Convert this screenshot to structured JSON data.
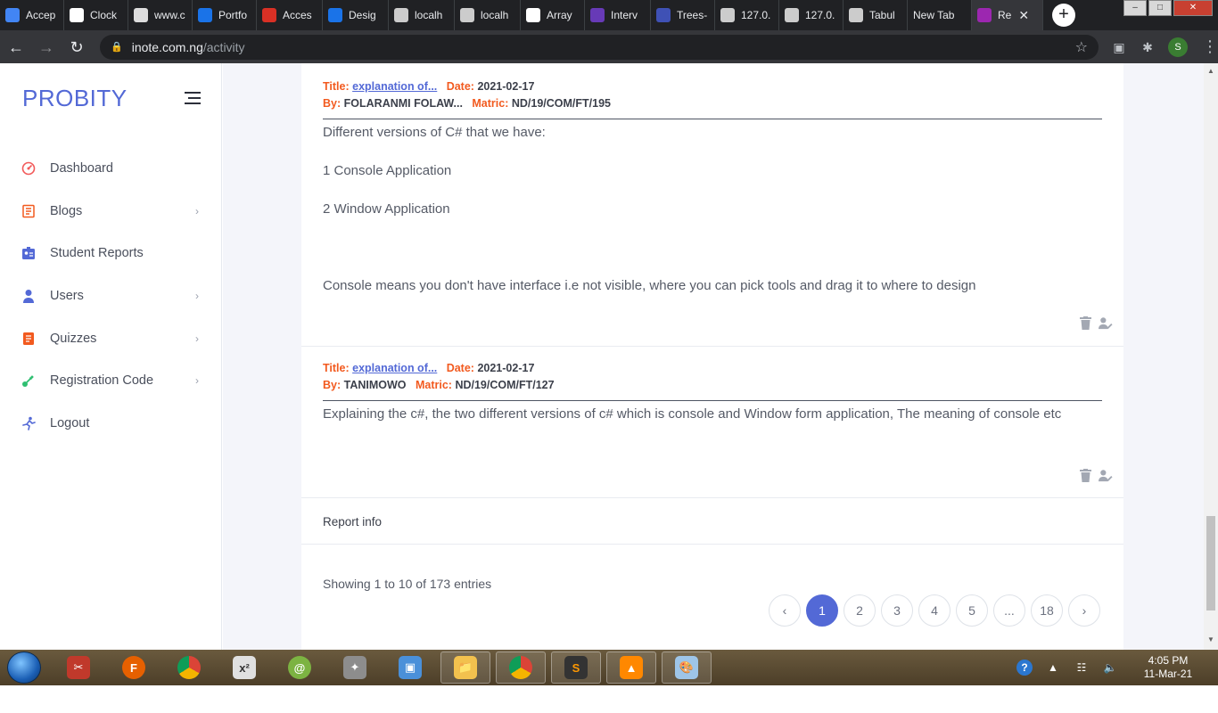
{
  "browser": {
    "tabs": [
      {
        "label": "Accep",
        "icon": "docs-icon",
        "color": "#4285f4"
      },
      {
        "label": "Clock",
        "icon": "clock-icon",
        "color": "#ffffff"
      },
      {
        "label": "www.c",
        "icon": "globe-icon",
        "color": "#dddddd"
      },
      {
        "label": "Portfo",
        "icon": "canva-icon",
        "color": "#1a73e8"
      },
      {
        "label": "Acces",
        "icon": "mail-icon",
        "color": "#d93025"
      },
      {
        "label": "Desig",
        "icon": "canva-icon",
        "color": "#1a73e8"
      },
      {
        "label": "localh",
        "icon": "server-icon",
        "color": "#cccccc"
      },
      {
        "label": "localh",
        "icon": "server-icon",
        "color": "#cccccc"
      },
      {
        "label": "Array",
        "icon": "bird-icon",
        "color": "#ffffff"
      },
      {
        "label": "Interv",
        "icon": "list-icon",
        "color": "#673ab7"
      },
      {
        "label": "Trees-",
        "icon": "square-icon",
        "color": "#3f51b5"
      },
      {
        "label": "127.0.",
        "icon": "globe-icon",
        "color": "#cccccc"
      },
      {
        "label": "127.0.",
        "icon": "globe-icon",
        "color": "#cccccc"
      },
      {
        "label": "Tabul",
        "icon": "globe-icon",
        "color": "#cccccc"
      },
      {
        "label": "New Tab",
        "icon": "",
        "color": ""
      },
      {
        "label": "Re",
        "icon": "app-icon",
        "color": "#9c27b0",
        "active": true
      }
    ],
    "url_host": "inote.com.ng",
    "url_path": "/activity",
    "profile_initial": "S"
  },
  "sidebar": {
    "brand": "PROBITY",
    "items": [
      {
        "label": "Dashboard",
        "icon": "dashboard-icon",
        "color": "#f25a5a",
        "chevron": false
      },
      {
        "label": "Blogs",
        "icon": "blog-icon",
        "color": "#f25a1f",
        "chevron": true
      },
      {
        "label": "Student Reports",
        "icon": "id-card-icon",
        "color": "#5369d6",
        "chevron": false
      },
      {
        "label": "Users",
        "icon": "user-icon",
        "color": "#5369d6",
        "chevron": true
      },
      {
        "label": "Quizzes",
        "icon": "quiz-icon",
        "color": "#f25a1f",
        "chevron": true
      },
      {
        "label": "Registration Code",
        "icon": "key-icon",
        "color": "#2fbf71",
        "chevron": true
      },
      {
        "label": "Logout",
        "icon": "logout-icon",
        "color": "#5369d6",
        "chevron": false
      }
    ]
  },
  "entries": [
    {
      "title_key": "Title:",
      "title": "explanation of...",
      "date_key": "Date:",
      "date": "2021-02-17",
      "by_key": "By:",
      "by": "FOLARANMI FOLAW...",
      "matric_key": "Matric:",
      "matric": "ND/19/COM/FT/195",
      "lines": [
        "Different versions of C# that we have:",
        "",
        "1 Console Application",
        "",
        "2 Window Application",
        "",
        "",
        "",
        "",
        "Console means you don't have interface i.e not visible, where you can pick tools and drag it to where to design"
      ]
    },
    {
      "title_key": "Title:",
      "title": "explanation of...",
      "date_key": "Date:",
      "date": "2021-02-17",
      "by_key": "By:",
      "by": "TANIMOWO",
      "matric_key": "Matric:",
      "matric": "ND/19/COM/FT/127",
      "lines": [
        "Explaining the c#, the two different versions of c# which is console and Window form application, The meaning of console etc"
      ]
    }
  ],
  "report_info": "Report info",
  "showing": "Showing 1 to 10 of 173 entries",
  "pagination": {
    "prev": "‹",
    "pages": [
      "1",
      "2",
      "3",
      "4",
      "5",
      "...",
      "18"
    ],
    "active": "1",
    "next": "›"
  },
  "taskbar": {
    "time": "4:05 PM",
    "date": "11-Mar-21"
  }
}
